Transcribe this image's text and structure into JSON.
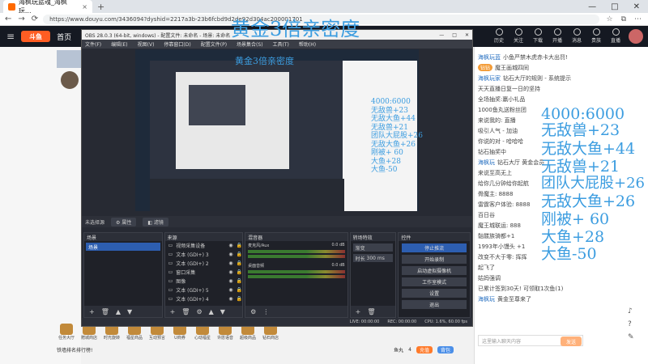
{
  "browser": {
    "tab_title": "海枫玩蓝魂_海枫玩...",
    "url": "https://www.douyu.com/3436094?dyshid=2217a3b-23b6fcbd9d2de92d304ac200001701",
    "icons": [
      "back-icon",
      "forward-icon",
      "refresh-icon",
      "star-icon",
      "extensions-icon",
      "menu-icon"
    ]
  },
  "douyu": {
    "logo": "斗鱼",
    "home": "首页",
    "header_icons": [
      {
        "name": "history",
        "label": "历史"
      },
      {
        "name": "follow",
        "label": "关注"
      },
      {
        "name": "download",
        "label": "下载"
      },
      {
        "name": "open",
        "label": "开播"
      },
      {
        "name": "message",
        "label": "消息"
      },
      {
        "name": "vip",
        "label": "贵族"
      },
      {
        "name": "live",
        "label": "直播"
      }
    ],
    "bottom_icons": [
      "任务大厅",
      "赠城商店",
      "时光旋转",
      "福星商品",
      "互动预言",
      "U商券",
      "心动福星",
      "许愿语音",
      "超级商品",
      "钻石商店"
    ],
    "bottom_bar": {
      "notice": "铁墙排名排行榜!",
      "followers": "鱼丸",
      "likes": "4",
      "btn1": "充值",
      "btn2": "背包"
    },
    "chat_lines": [
      {
        "badge": "",
        "name": "海枫玩蓝",
        "text": "小鱼严禁木虎赤卡大出罚!"
      },
      {
        "badge": "钻钻",
        "name": "",
        "text": "魔王画城四同"
      },
      {
        "badge": "",
        "name": "海枫玩家",
        "text": "钻石大厅的规则 - 系统提示"
      },
      {
        "badge": "",
        "name": "",
        "text": "天天直播日复一日的坚持"
      },
      {
        "badge": "",
        "name": "",
        "text": "全场抽奖:赢小礼品"
      },
      {
        "badge": "",
        "name": "",
        "text": "1000鱼丸送粉丝团"
      },
      {
        "badge": "",
        "name": "",
        "text": "来说我的: 直播"
      },
      {
        "badge": "",
        "name": "",
        "text": "吸引人气 - 加油"
      },
      {
        "badge": "",
        "name": "",
        "text": "你说的对 - 哈哈哈"
      },
      {
        "badge": "",
        "name": "",
        "text": "钻石抽奖中"
      },
      {
        "badge": "",
        "name": "海枫玩",
        "text": "钻石大厅 黄金会员"
      },
      {
        "badge": "",
        "name": "",
        "text": "来说至高无上"
      },
      {
        "badge": "",
        "name": "",
        "text": "给你几分钟给你起航"
      },
      {
        "badge": "",
        "name": "",
        "text": "骨魔主: 8888"
      },
      {
        "badge": "",
        "name": "",
        "text": "雷霆客户体验: 8888"
      },
      {
        "badge": "",
        "name": "",
        "text": "百日谷"
      },
      {
        "badge": "",
        "name": "",
        "text": "魔王城联运: 888"
      },
      {
        "badge": "",
        "name": "",
        "text": "骷髅族骑都+1"
      },
      {
        "badge": "",
        "name": "",
        "text": "1993年小馒头 +1"
      },
      {
        "badge": "",
        "name": "",
        "text": "改变不大于零: 挥挥"
      },
      {
        "badge": "",
        "name": "",
        "text": "起飞了"
      },
      {
        "badge": "",
        "name": "",
        "text": "姑妈强调"
      },
      {
        "badge": "",
        "name": "",
        "text": "已累计签到30天! 可领取1次鱼(1)"
      },
      {
        "badge": "",
        "name": "海枫玩",
        "text": "黄金至尊来了"
      }
    ],
    "chat_placeholder": "这里输入聊天内容",
    "send": "发送"
  },
  "obs": {
    "title": "OBS 28.0.3 (64-bit, windows) - 配置文件: 未命名 - 场景: 未命名",
    "menu": [
      "文件(F)",
      "编辑(E)",
      "视图(V)",
      "停靠窗口(D)",
      "配置文件(P)",
      "场景集合(S)",
      "工具(T)",
      "帮助(H)"
    ],
    "no_source": "未选择源",
    "props_btn": "属性",
    "filter_btn": "滤镜",
    "docks": {
      "scenes": {
        "title": "场景",
        "items": [
          "场景"
        ]
      },
      "sources": {
        "title": "来源",
        "items": [
          "视频采集设备",
          "文本 (GDI+) 3",
          "文本 (GDI+) 2",
          "窗口采集",
          "图像",
          "文本 (GDI+) 5",
          "文本 (GDI+) 4"
        ]
      },
      "mixer": {
        "title": "混音器",
        "channels": [
          {
            "name": "麦克风/Aux",
            "db": "0.0 dB"
          },
          {
            "name": "桌面音频",
            "db": "0.0 dB"
          }
        ]
      },
      "transitions": {
        "title": "转场特效",
        "selected": "渐变",
        "duration_label": "时长",
        "duration": "300 ms"
      },
      "controls": {
        "title": "控件",
        "buttons": [
          "停止推流",
          "开始录制",
          "启动虚拟摄像机",
          "工作室模式",
          "设置",
          "退出"
        ]
      }
    },
    "status": {
      "live": "LIVE: 00:00:00",
      "rec": "REC: 00:00:00",
      "cpu": "CPU: 1.6%, 60.00 fps"
    }
  },
  "overlay": {
    "title": "黄金3倍亲密度",
    "lines": [
      "4000:6000",
      "无敌兽+23",
      "无敌大鱼+44",
      "无敌兽+21",
      "团队大屁股+26",
      "无敌大鱼+26",
      "刚被+ 60",
      "大鱼+28",
      "大鱼-50"
    ]
  },
  "colors": {
    "overlay": "#3c9de0",
    "obs_bg": "#272a33",
    "accent": "#2d5eb0",
    "douyu_orange": "#ff5d23"
  }
}
